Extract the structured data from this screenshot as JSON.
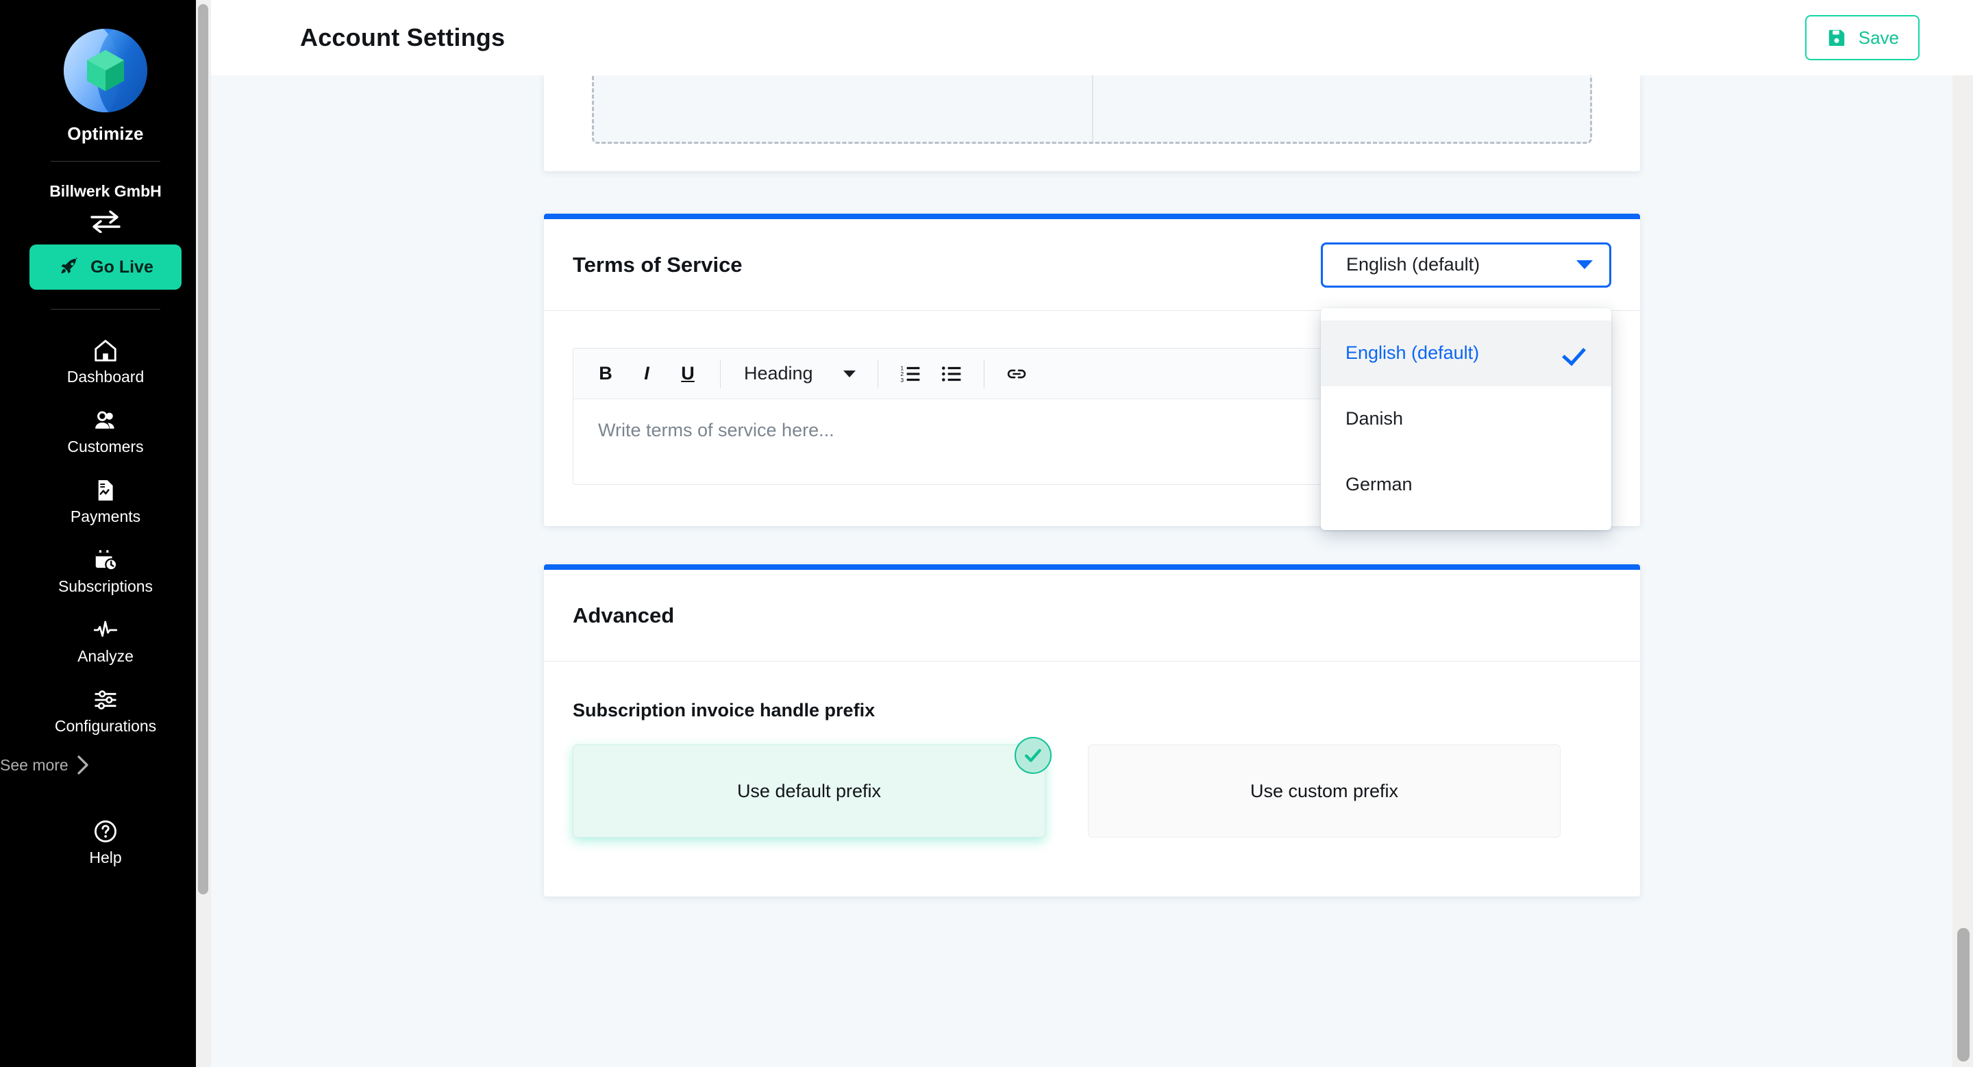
{
  "sidebar": {
    "brand_name": "Optimize",
    "org_name": "Billwerk GmbH",
    "switch_org_icon": "switch-arrows-icon",
    "go_live_label": "Go Live",
    "go_live_icon": "rocket-icon",
    "nav_items": [
      {
        "label": "Dashboard",
        "icon": "home-icon"
      },
      {
        "label": "Customers",
        "icon": "users-icon"
      },
      {
        "label": "Payments",
        "icon": "document-chart-icon"
      },
      {
        "label": "Subscriptions",
        "icon": "calendar-clock-icon"
      },
      {
        "label": "Analyze",
        "icon": "pulse-icon"
      },
      {
        "label": "Configurations",
        "icon": "sliders-icon"
      }
    ],
    "see_more_label": "See more",
    "see_more_icon": "chevron-right-icon",
    "help": {
      "label": "Help",
      "icon": "question-circle-icon"
    }
  },
  "topbar": {
    "title": "Account Settings",
    "save_label": "Save",
    "save_icon": "floppy-disk-icon"
  },
  "terms_card": {
    "title": "Terms of Service",
    "language_select": {
      "value": "English (default)",
      "caret_icon": "chevron-down-icon",
      "open": true,
      "options": [
        {
          "label": "English (default)",
          "selected": true
        },
        {
          "label": "Danish",
          "selected": false
        },
        {
          "label": "German",
          "selected": false
        }
      ]
    },
    "editor": {
      "toolbar": {
        "bold": "B",
        "italic": "I",
        "underline": "U",
        "heading_label": "Heading",
        "ordered_list_icon": "ordered-list-icon",
        "bullet_list_icon": "bullet-list-icon",
        "link_icon": "link-icon"
      },
      "placeholder": "Write terms of service here..."
    }
  },
  "advanced_card": {
    "title": "Advanced",
    "prefix_section_label": "Subscription invoice handle prefix",
    "options": [
      {
        "label": "Use default prefix",
        "selected": true
      },
      {
        "label": "Use custom prefix",
        "selected": false
      }
    ],
    "check_icon": "check-badge-icon"
  },
  "colors": {
    "accent_blue": "#0a66f5",
    "accent_green": "#14d6a5",
    "sidebar_bg": "#000000",
    "page_bg": "#f4f8fb"
  }
}
